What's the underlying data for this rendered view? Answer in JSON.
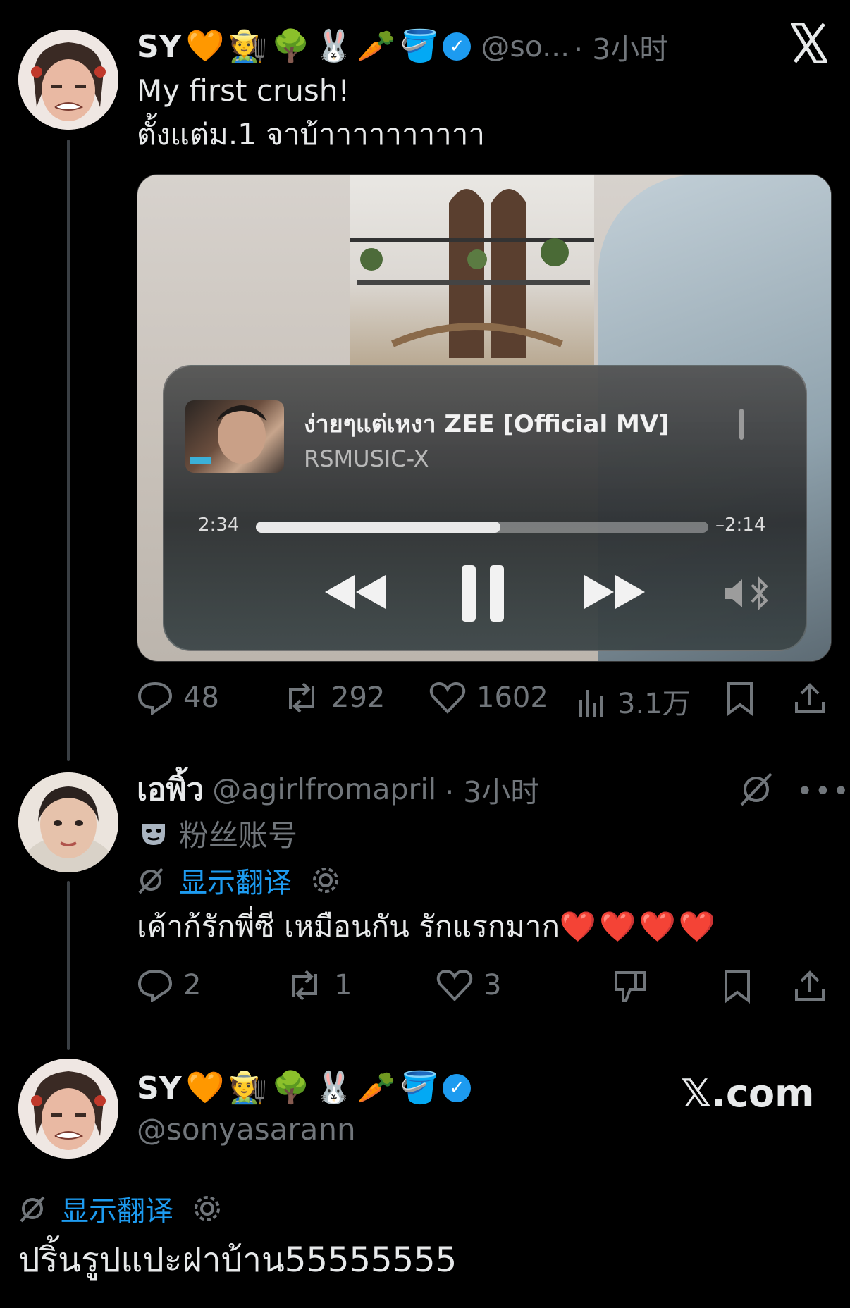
{
  "post1": {
    "name": "SY",
    "emojis": [
      "🧡",
      "🧑‍🌾",
      "🌳",
      "🐰",
      "🥕",
      "🪣"
    ],
    "handle": "@so...",
    "time": "· 3小时",
    "text_line1": "My first crush!",
    "text_line2": "ตั้งแต่ม.1 จาบ้าาาาาาาาาา",
    "player": {
      "song_title": "ง่ายๆแต่เหงา ZEE [Official MV]",
      "artist": "RSMUSIC-X",
      "elapsed": "2:34",
      "remaining": "–2:14",
      "progress_fraction": 0.54
    },
    "stats": {
      "replies": "48",
      "reposts": "292",
      "likes": "1602",
      "views": "3.1万"
    }
  },
  "post2": {
    "name": "เอพิ้ว",
    "handle": "@agirlfromapril",
    "time": "· 3小时",
    "fan_label": "粉丝账号",
    "translate_label": "显示翻译",
    "text": "เค้าก้รักพี่ซี เหมือนกัน รักแรกมาก",
    "hearts": "❤️❤️❤️❤️",
    "stats": {
      "replies": "2",
      "reposts": "1",
      "likes": "3"
    }
  },
  "post3": {
    "name": "SY",
    "emojis": [
      "🧡",
      "🧑‍🌾",
      "🌳",
      "🐰",
      "🥕",
      "🪣"
    ],
    "handle": "@sonyasarann",
    "translate_label": "显示翻译",
    "text": "ปริ้นรูปแปะฝาบ้าน55555555"
  },
  "branding": {
    "watermark": "𝕏.com"
  },
  "colors": {
    "background": "#000000",
    "text": "#e7e9ea",
    "muted": "#71767b",
    "link": "#1d9bf0"
  }
}
